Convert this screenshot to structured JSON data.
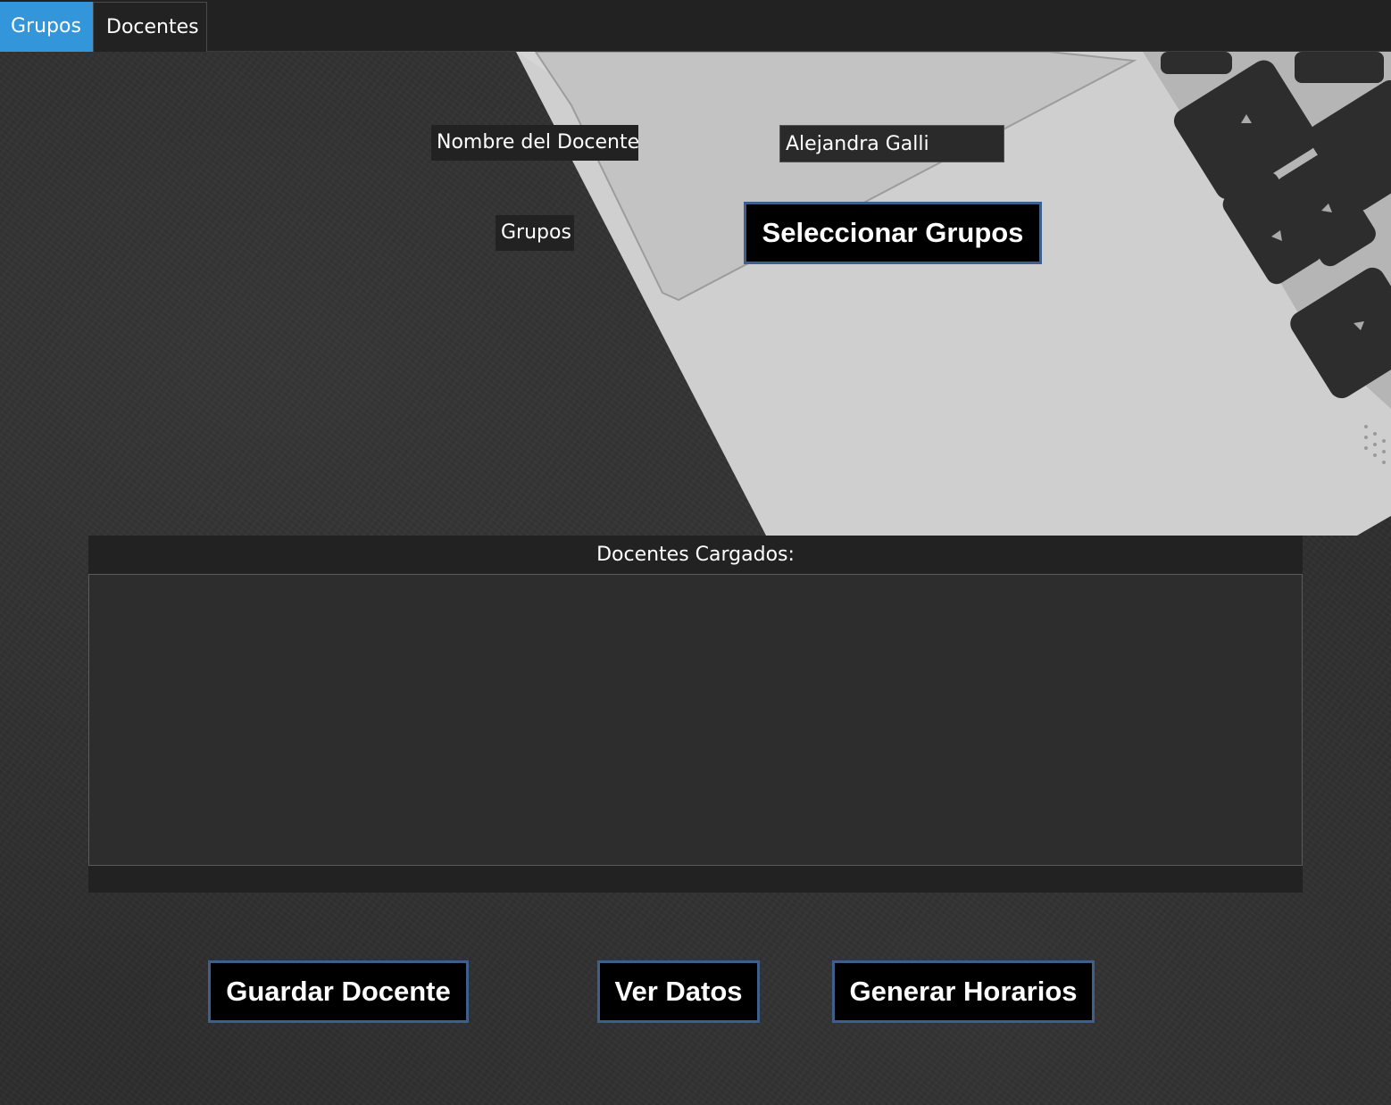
{
  "tabs": [
    {
      "label": "Grupos",
      "active": true
    },
    {
      "label": "Docentes",
      "active": false
    }
  ],
  "form": {
    "nombre_label": "Nombre del Docente",
    "nombre_value": "Alejandra Galli",
    "grupos_label": "Grupos",
    "seleccionar_label": "Seleccionar Grupos"
  },
  "list_panel": {
    "title": "Docentes Cargados:",
    "items": []
  },
  "actions": {
    "guardar_label": "Guardar Docente",
    "ver_label": "Ver Datos",
    "generar_label": "Generar Horarios"
  },
  "colors": {
    "accent": "#3396da",
    "button_border": "#3e5f8a",
    "button_bg": "#000000",
    "panel_bg": "#2d2d2d"
  }
}
